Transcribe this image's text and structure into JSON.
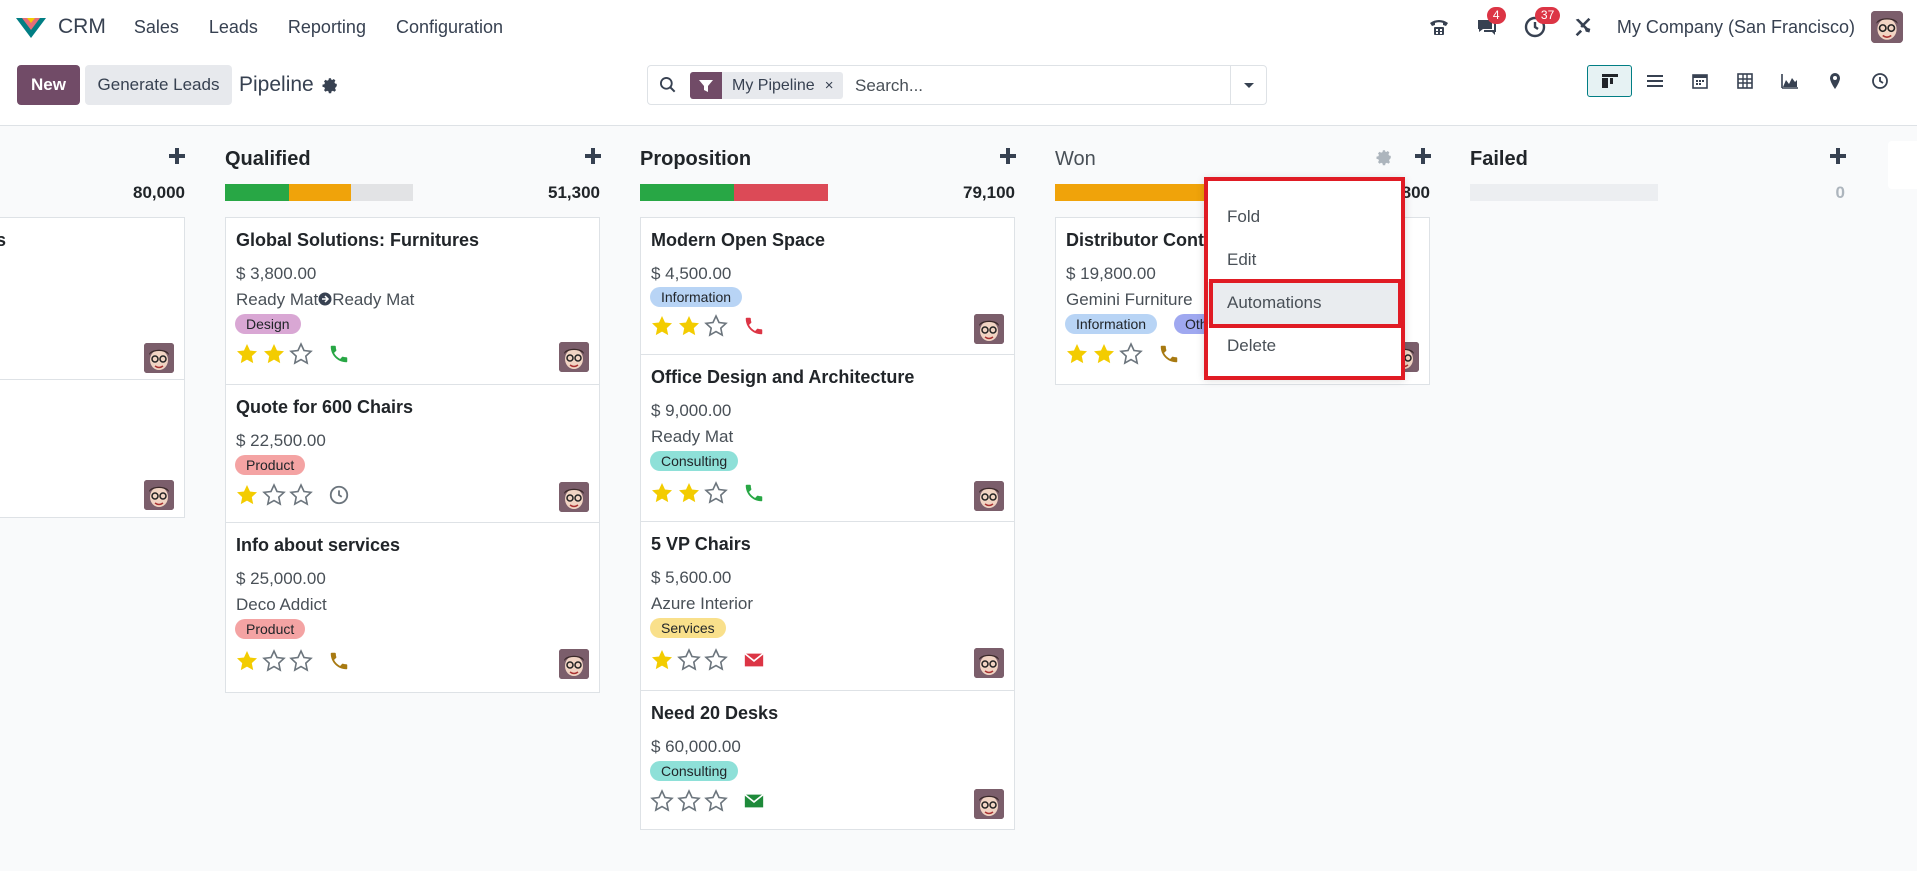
{
  "navbar": {
    "app_name": "CRM",
    "menu": [
      "Sales",
      "Leads",
      "Reporting",
      "Configuration"
    ],
    "badges": {
      "messages": "4",
      "activities": "37"
    },
    "company": "My Company (San Francisco)"
  },
  "control": {
    "new_label": "New",
    "generate_label": "Generate Leads",
    "breadcrumb": "Pipeline",
    "facet_label": "My Pipeline",
    "facet_remove": "×",
    "search_placeholder": "Search..."
  },
  "views": [
    "kanban",
    "list",
    "calendar",
    "pivot",
    "graph",
    "map",
    "activity"
  ],
  "columns": [
    {
      "title": "",
      "total": "80,000",
      "cards": [
        {
          "title": "s"
        },
        {}
      ]
    },
    {
      "title": "Qualified",
      "total": "51,300",
      "progress": [
        {
          "color": "#28a745",
          "pct": 34
        },
        {
          "color": "#f0a30a",
          "pct": 33
        },
        {
          "color": "#e2e3e5",
          "pct": 33
        }
      ],
      "cards": [
        {
          "title": "Global Solutions: Furnitures",
          "amount": "$ 3,800.00",
          "company": "Ready Mat",
          "company2": "Ready Mat",
          "tag": "Design",
          "stars": 2,
          "activity": "phone-green"
        },
        {
          "title": "Quote for 600 Chairs",
          "amount": "$ 22,500.00",
          "tag": "Product",
          "stars": 1,
          "activity": "clock"
        },
        {
          "title": "Info about services",
          "amount": "$ 25,000.00",
          "company": "Deco Addict",
          "tag": "Product",
          "stars": 1,
          "activity": "phone-orange"
        }
      ]
    },
    {
      "title": "Proposition",
      "total": "79,100",
      "progress": [
        {
          "color": "#28a745",
          "pct": 50
        },
        {
          "color": "#dc4a57",
          "pct": 50
        }
      ],
      "cards": [
        {
          "title": "Modern Open Space",
          "amount": "$ 4,500.00",
          "tag": "Information",
          "stars": 2,
          "activity": "phone-red"
        },
        {
          "title": "Office Design and Architecture",
          "amount": "$ 9,000.00",
          "company": "Ready Mat",
          "tag": "Consulting",
          "stars": 2,
          "activity": "phone-green"
        },
        {
          "title": "5 VP Chairs",
          "amount": "$ 5,600.00",
          "company": "Azure Interior",
          "tag": "Services",
          "stars": 1,
          "activity": "mail-red"
        },
        {
          "title": "Need 20 Desks",
          "amount": "$ 60,000.00",
          "tag": "Consulting",
          "stars": 0,
          "activity": "mail-green"
        }
      ]
    },
    {
      "title": "Won",
      "total": "19,800",
      "progress": [
        {
          "color": "#f0a30a",
          "pct": 100
        }
      ],
      "cards": [
        {
          "title": "Distributor Contract",
          "amount": "$ 19,800.00",
          "company": "Gemini Furniture",
          "tags": [
            "Information",
            "Other"
          ],
          "stars": 2,
          "activity": "phone-orange"
        }
      ]
    },
    {
      "title": "Failed",
      "total": "0",
      "cards": []
    }
  ],
  "dropdown": {
    "items": [
      "Fold",
      "Edit",
      "Automations",
      "Delete"
    ],
    "highlighted": "Automations"
  },
  "colors": {
    "brand": "#714b67",
    "teal": "#017e84",
    "highlight_box": "#e01b24",
    "star": "#f3cc00"
  }
}
